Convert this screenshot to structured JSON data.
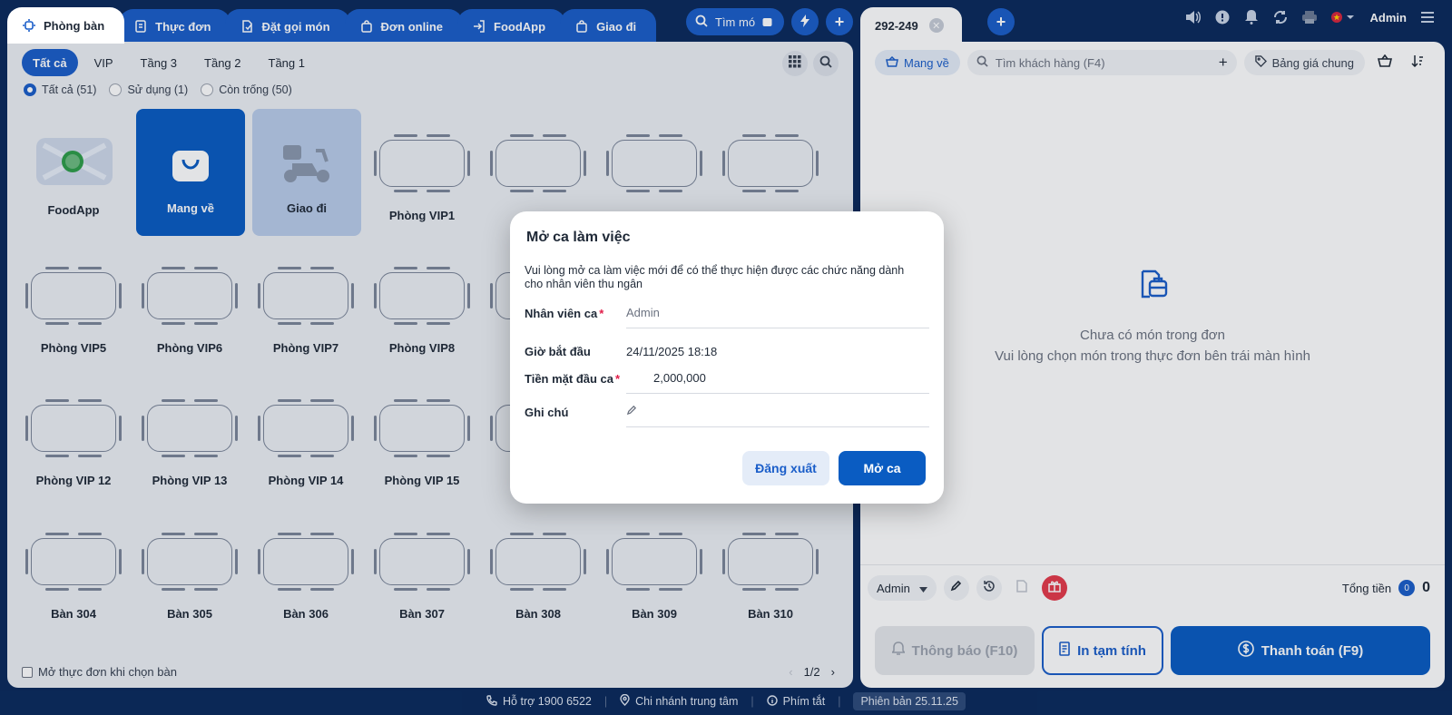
{
  "top_tabs": [
    {
      "label": "Phòng bàn",
      "icon": "table-icon"
    },
    {
      "label": "Thực đơn",
      "icon": "menu-book-icon"
    },
    {
      "label": "Đặt gọi món",
      "icon": "order-icon"
    },
    {
      "label": "Đơn online",
      "icon": "bag-icon"
    },
    {
      "label": "FoodApp",
      "icon": "login-icon"
    },
    {
      "label": "Giao đi",
      "icon": "bag-icon"
    }
  ],
  "top_search": {
    "label": "Tìm mó"
  },
  "filter_tabs": [
    "Tất cả",
    "VIP",
    "Tầng 3",
    "Tầng 2",
    "Tầng 1"
  ],
  "status_filters": [
    {
      "label": "Tất cả (51)",
      "checked": true
    },
    {
      "label": "Sử dụng (1)",
      "checked": false
    },
    {
      "label": "Còn trống (50)",
      "checked": false
    }
  ],
  "tables": [
    [
      "FoodApp",
      "Mang về",
      "Giao đi",
      "Phòng VIP1",
      "",
      "",
      ""
    ],
    [
      "Phòng VIP5",
      "Phòng VIP6",
      "Phòng VIP7",
      "Phòng VIP8",
      "",
      "",
      ""
    ],
    [
      "Phòng VIP 12",
      "Phòng VIP 13",
      "Phòng VIP 14",
      "Phòng VIP 15",
      "",
      "",
      ""
    ],
    [
      "Bàn 304",
      "Bàn 305",
      "Bàn 306",
      "Bàn 307",
      "Bàn 308",
      "Bàn 309",
      "Bàn 310"
    ]
  ],
  "bottom_left": {
    "checkbox_label": "Mở thực đơn khi chọn bàn"
  },
  "pager": {
    "page": "1/2"
  },
  "right": {
    "order_tab": "292-249",
    "user": "Admin",
    "service_type": "Mang về",
    "customer_search_placeholder": "Tìm khách hàng (F4)",
    "price_list": "Bảng giá chung",
    "empty_line1": "Chưa có món trong đơn",
    "empty_line2": "Vui lòng chọn món trong thực đơn bên trái màn hình",
    "staff": "Admin",
    "total_label": "Tổng tiền",
    "total_count": "0",
    "total_amount": "0",
    "btn_notify": "Thông báo (F10)",
    "btn_print": "In tạm tính",
    "btn_pay": "Thanh toán (F9)"
  },
  "status_bar": {
    "support": "Hỗ trợ 1900 6522",
    "branch": "Chi nhánh trung tâm",
    "shortcuts": "Phím tắt",
    "version": "Phiên bản 25.11.25"
  },
  "modal": {
    "title": "Mở ca làm việc",
    "description": "Vui lòng mở ca làm việc mới để có thể thực hiện được các chức năng dành cho nhân viên thu ngân",
    "staff_label": "Nhân viên ca",
    "staff_value": "Admin",
    "start_label": "Giờ bắt đầu",
    "start_value": "24/11/2025 18:18",
    "cash_label": "Tiền mặt đầu ca",
    "cash_value": "2,000,000",
    "note_label": "Ghi chú",
    "btn_logout": "Đăng xuất",
    "btn_open": "Mở ca"
  },
  "colors": {
    "primary": "#0a5cc2",
    "navy_bg": "#0b2a5c",
    "danger": "#e53b4b"
  }
}
